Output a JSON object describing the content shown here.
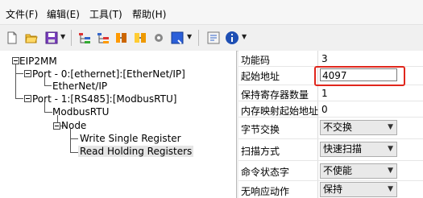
{
  "menubar": {
    "file": "文件(F)",
    "edit": "编辑(E)",
    "tools": "工具(T)",
    "help": "帮助(H)"
  },
  "toolbar": {
    "icons": [
      "new-file-icon",
      "open-folder-icon",
      "save-icon",
      "dropdown-icon",
      "tree-add-icon",
      "tree-edit-icon",
      "tree-move-icon",
      "tree-delete-icon",
      "settings-icon",
      "module-icon",
      "dropdown-icon",
      "config-icon",
      "info-icon",
      "dropdown-icon"
    ]
  },
  "tree": {
    "root": "EIP2MM",
    "port0": "Port - 0:[ethernet]:[EtherNet/IP]",
    "port0_child": "EtherNet/IP",
    "port1": "Port - 1:[RS485]:[ModbusRTU]",
    "modbus": "ModbusRTU",
    "node": "Node",
    "write": "Write Single Register",
    "read": "Read Holding Registers"
  },
  "properties": {
    "function_code_label": "功能码",
    "function_code_value": "3",
    "start_address_label": "起始地址",
    "start_address_value": "4097",
    "register_count_label": "保持寄存器数量",
    "register_count_value": "1",
    "memory_map_label": "内存映射起始地址",
    "memory_map_value": "0",
    "byte_swap_label": "字节交换",
    "byte_swap_value": "不交换",
    "scan_mode_label": "扫描方式",
    "scan_mode_value": "快速扫描",
    "cmd_status_label": "命令状态字",
    "cmd_status_value": "不使能",
    "no_response_label": "无响应动作",
    "no_response_value": "保持"
  },
  "colors": {
    "highlight": "#e0261c",
    "selection": "#e5e5e5"
  }
}
